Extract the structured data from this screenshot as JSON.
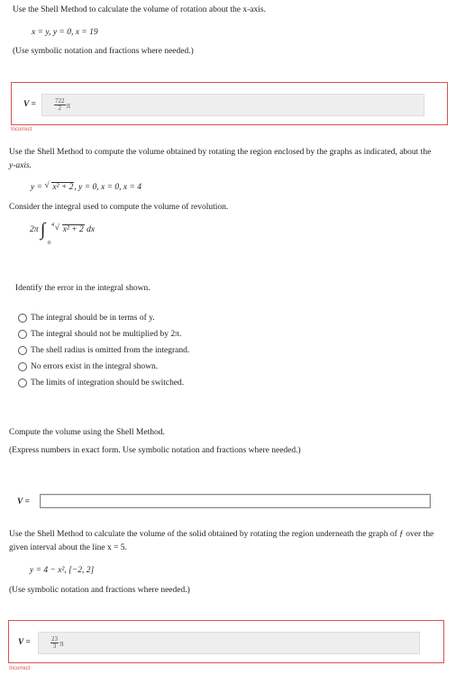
{
  "q1": {
    "prompt": "Use the Shell Method to calculate the volume of rotation about the x-axis.",
    "equations": "x = y,   y = 0,   x = 19",
    "note": "(Use symbolic notation and fractions where needed.)",
    "answer_label": "V =",
    "answer_num": "722",
    "answer_den": "2",
    "answer_suffix": "π",
    "status": "Incorrect"
  },
  "q2": {
    "prompt_line1": "Use the Shell Method to compute the volume obtained by rotating the region enclosed by the graphs as indicated, about the",
    "prompt_line2": "y-axis.",
    "eq_prefix": "y = ",
    "eq_radicand": "x² + 2",
    "eq_rest": ",   y = 0,   x = 0,   x = 4",
    "consider": "Consider the integral used to compute the volume of revolution.",
    "integral_coef": "2π",
    "integral_upper": "4",
    "integral_lower": "0",
    "integral_radicand": "x² + 2",
    "integral_dx": "dx",
    "identify": "Identify the error in the integral shown.",
    "options": [
      "The integral should be in terms of y.",
      "The integral should not be multiplied by 2π.",
      "The shell radius is omitted from the integrand.",
      "No errors exist in the integral shown.",
      "The limits of integration should be switched."
    ]
  },
  "q3": {
    "prompt": "Compute the volume using the Shell Method.",
    "note": "(Express numbers in exact form. Use symbolic notation and fractions where needed.)",
    "answer_label": "V =",
    "answer_value": ""
  },
  "q4": {
    "prompt_line1": "Use the Shell Method to calculate the volume of the solid obtained by rotating the region underneath the graph of ƒ over the",
    "prompt_line2": "given interval about the line x = 5.",
    "equation": "y = 4 − x²,   [−2, 2]",
    "note": "(Use symbolic notation and fractions where needed.)",
    "answer_label": "V =",
    "answer_num": "23",
    "answer_den": "3",
    "answer_suffix": "π",
    "status": "Incorrect"
  },
  "colors": {
    "error_red": "#d9534f",
    "field_gray": "#eeeeee"
  }
}
